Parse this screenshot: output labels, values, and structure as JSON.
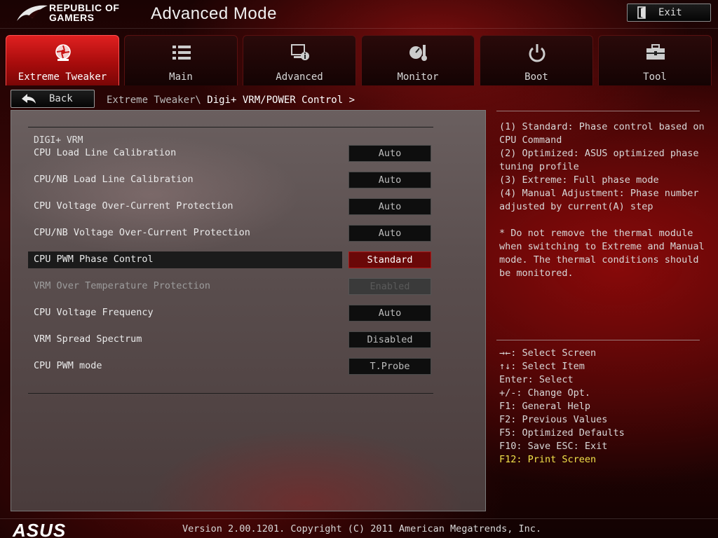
{
  "header": {
    "brand_line1": "REPUBLIC OF",
    "brand_line2": "GAMERS",
    "mode_title": "Advanced Mode",
    "exit_label": "Exit"
  },
  "tabs": [
    {
      "label": "Extreme Tweaker",
      "icon": "cpu-fan-icon",
      "active": true
    },
    {
      "label": "Main",
      "icon": "list-icon",
      "active": false
    },
    {
      "label": "Advanced",
      "icon": "advanced-settings-icon",
      "active": false
    },
    {
      "label": "Monitor",
      "icon": "monitor-gauge-icon",
      "active": false
    },
    {
      "label": "Boot",
      "icon": "power-icon",
      "active": false
    },
    {
      "label": "Tool",
      "icon": "toolbox-icon",
      "active": false
    }
  ],
  "nav": {
    "back_label": "Back",
    "breadcrumb_parent": "Extreme Tweaker\\",
    "breadcrumb_current": "Digi+ VRM/POWER Control >"
  },
  "section_title": "DIGI+ VRM",
  "settings": [
    {
      "label": "CPU Load Line Calibration",
      "value": "Auto"
    },
    {
      "label": "CPU/NB Load Line Calibration",
      "value": "Auto"
    },
    {
      "label": "CPU Voltage Over-Current Protection",
      "value": "Auto"
    },
    {
      "label": "CPU/NB Voltage Over-Current Protection",
      "value": "Auto"
    },
    {
      "label": "CPU PWM Phase Control",
      "value": "Standard",
      "selected": true
    },
    {
      "label": "VRM Over Temperature Protection",
      "value": "Enabled",
      "disabled": true
    },
    {
      "label": "CPU Voltage Frequency",
      "value": "Auto"
    },
    {
      "label": "VRM Spread Spectrum",
      "value": "Disabled"
    },
    {
      "label": "CPU PWM mode",
      "value": "T.Probe"
    }
  ],
  "help": {
    "lines": [
      "(1) Standard: Phase control based on",
      "CPU Command",
      "(2) Optimized: ASUS optimized phase",
      "tuning profile",
      "(3) Extreme: Full phase mode",
      "(4) Manual Adjustment: Phase number",
      "adjusted by current(A) step",
      "",
      "* Do not remove the thermal module",
      "when switching to Extreme and Manual",
      "mode. The thermal conditions should",
      "be monitored."
    ]
  },
  "keys": [
    "→←: Select Screen",
    "↑↓: Select Item",
    "Enter: Select",
    "+/-: Change Opt.",
    "F1: General Help",
    "F2: Previous Values",
    "F5: Optimized Defaults",
    "F10: Save  ESC: Exit",
    "F12: Print Screen"
  ],
  "footer": {
    "logo": "ASUS",
    "version": "Version 2.00.1201. Copyright (C) 2011 American Megatrends, Inc."
  },
  "colors": {
    "accent": "#c81414",
    "selected_value_bg": "#6a0808",
    "hotkey_highlight": "#f2e24a"
  }
}
